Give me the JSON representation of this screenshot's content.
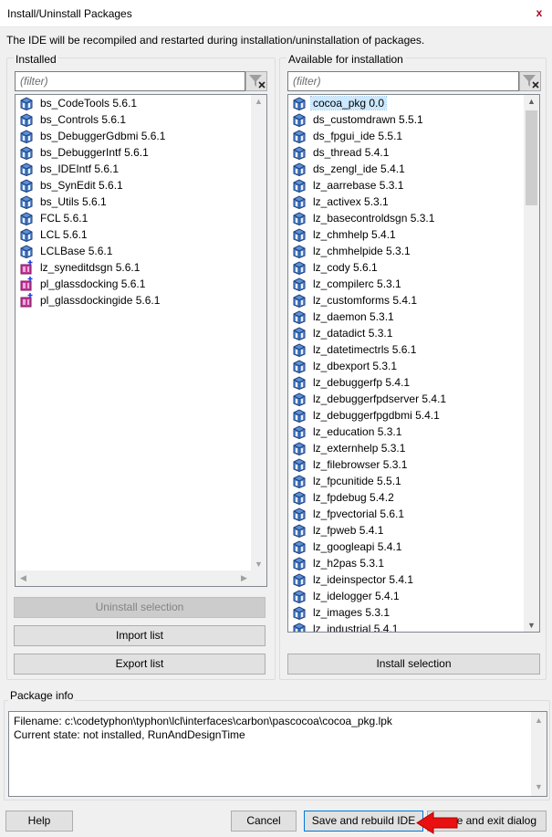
{
  "window": {
    "title": "Install/Uninstall Packages",
    "close_glyph": "x"
  },
  "hint": "The IDE will be recompiled and restarted during installation/uninstallation of packages.",
  "installed": {
    "label": "Installed",
    "filter_placeholder": "(filter)",
    "items": [
      {
        "label": "bs_CodeTools 5.6.1",
        "icon": "runtime-package-icon"
      },
      {
        "label": "bs_Controls 5.6.1",
        "icon": "runtime-package-icon"
      },
      {
        "label": "bs_DebuggerGdbmi 5.6.1",
        "icon": "runtime-package-icon"
      },
      {
        "label": "bs_DebuggerIntf 5.6.1",
        "icon": "runtime-package-icon"
      },
      {
        "label": "bs_IDEIntf 5.6.1",
        "icon": "runtime-package-icon"
      },
      {
        "label": "bs_SynEdit 5.6.1",
        "icon": "runtime-package-icon"
      },
      {
        "label": "bs_Utils 5.6.1",
        "icon": "runtime-package-icon"
      },
      {
        "label": "FCL 5.6.1",
        "icon": "runtime-package-icon"
      },
      {
        "label": "LCL 5.6.1",
        "icon": "runtime-package-icon"
      },
      {
        "label": "LCLBase 5.6.1",
        "icon": "runtime-package-icon"
      },
      {
        "label": "lz_syneditdsgn 5.6.1",
        "icon": "designtime-package-icon"
      },
      {
        "label": "pl_glassdocking 5.6.1",
        "icon": "designtime-package-icon"
      },
      {
        "label": "pl_glassdockingide 5.6.1",
        "icon": "designtime-package-icon"
      }
    ],
    "buttons": {
      "uninstall": "Uninstall selection",
      "import": "Import list",
      "export": "Export list"
    }
  },
  "available": {
    "label": "Available for installation",
    "filter_placeholder": "(filter)",
    "items": [
      {
        "label": "cocoa_pkg 0.0",
        "selected": true
      },
      {
        "label": "ds_customdrawn 5.5.1"
      },
      {
        "label": "ds_fpgui_ide 5.5.1"
      },
      {
        "label": "ds_thread 5.4.1"
      },
      {
        "label": "ds_zengl_ide 5.4.1"
      },
      {
        "label": "lz_aarrebase 5.3.1"
      },
      {
        "label": "lz_activex 5.3.1"
      },
      {
        "label": "lz_basecontroldsgn 5.3.1"
      },
      {
        "label": "lz_chmhelp 5.4.1"
      },
      {
        "label": "lz_chmhelpide 5.3.1"
      },
      {
        "label": "lz_cody 5.6.1"
      },
      {
        "label": "lz_compilerc 5.3.1"
      },
      {
        "label": "lz_customforms 5.4.1"
      },
      {
        "label": "lz_daemon 5.3.1"
      },
      {
        "label": "lz_datadict 5.3.1"
      },
      {
        "label": "lz_datetimectrls 5.6.1"
      },
      {
        "label": "lz_dbexport 5.3.1"
      },
      {
        "label": "lz_debuggerfp 5.4.1"
      },
      {
        "label": "lz_debuggerfpdserver 5.4.1"
      },
      {
        "label": "lz_debuggerfpgdbmi 5.4.1"
      },
      {
        "label": "lz_education 5.3.1"
      },
      {
        "label": "lz_externhelp 5.3.1"
      },
      {
        "label": "lz_filebrowser 5.3.1"
      },
      {
        "label": "lz_fpcunitide 5.5.1"
      },
      {
        "label": "lz_fpdebug 5.4.2"
      },
      {
        "label": "lz_fpvectorial 5.6.1"
      },
      {
        "label": "lz_fpweb 5.4.1"
      },
      {
        "label": "lz_googleapi 5.4.1"
      },
      {
        "label": "lz_h2pas 5.3.1"
      },
      {
        "label": "lz_ideinspector 5.4.1"
      },
      {
        "label": "lz_idelogger 5.4.1"
      },
      {
        "label": "lz_images 5.3.1"
      },
      {
        "label": "lz_industrial 5.4.1"
      }
    ],
    "buttons": {
      "install": "Install selection"
    }
  },
  "package_info": {
    "label": "Package info",
    "filename_line": "Filename:  c:\\codetyphon\\typhon\\lcl\\interfaces\\carbon\\pascocoa\\cocoa_pkg.lpk",
    "state_line": "Current state: not installed, RunAndDesignTime"
  },
  "footer": {
    "help": "Help",
    "cancel": "Cancel",
    "save_rebuild": "Save and rebuild IDE",
    "save_exit_visible": "e and exit dialog"
  },
  "colors": {
    "selection": "#cce8ff",
    "annotation_arrow": "#e81010",
    "primary_border": "#0078d7"
  }
}
